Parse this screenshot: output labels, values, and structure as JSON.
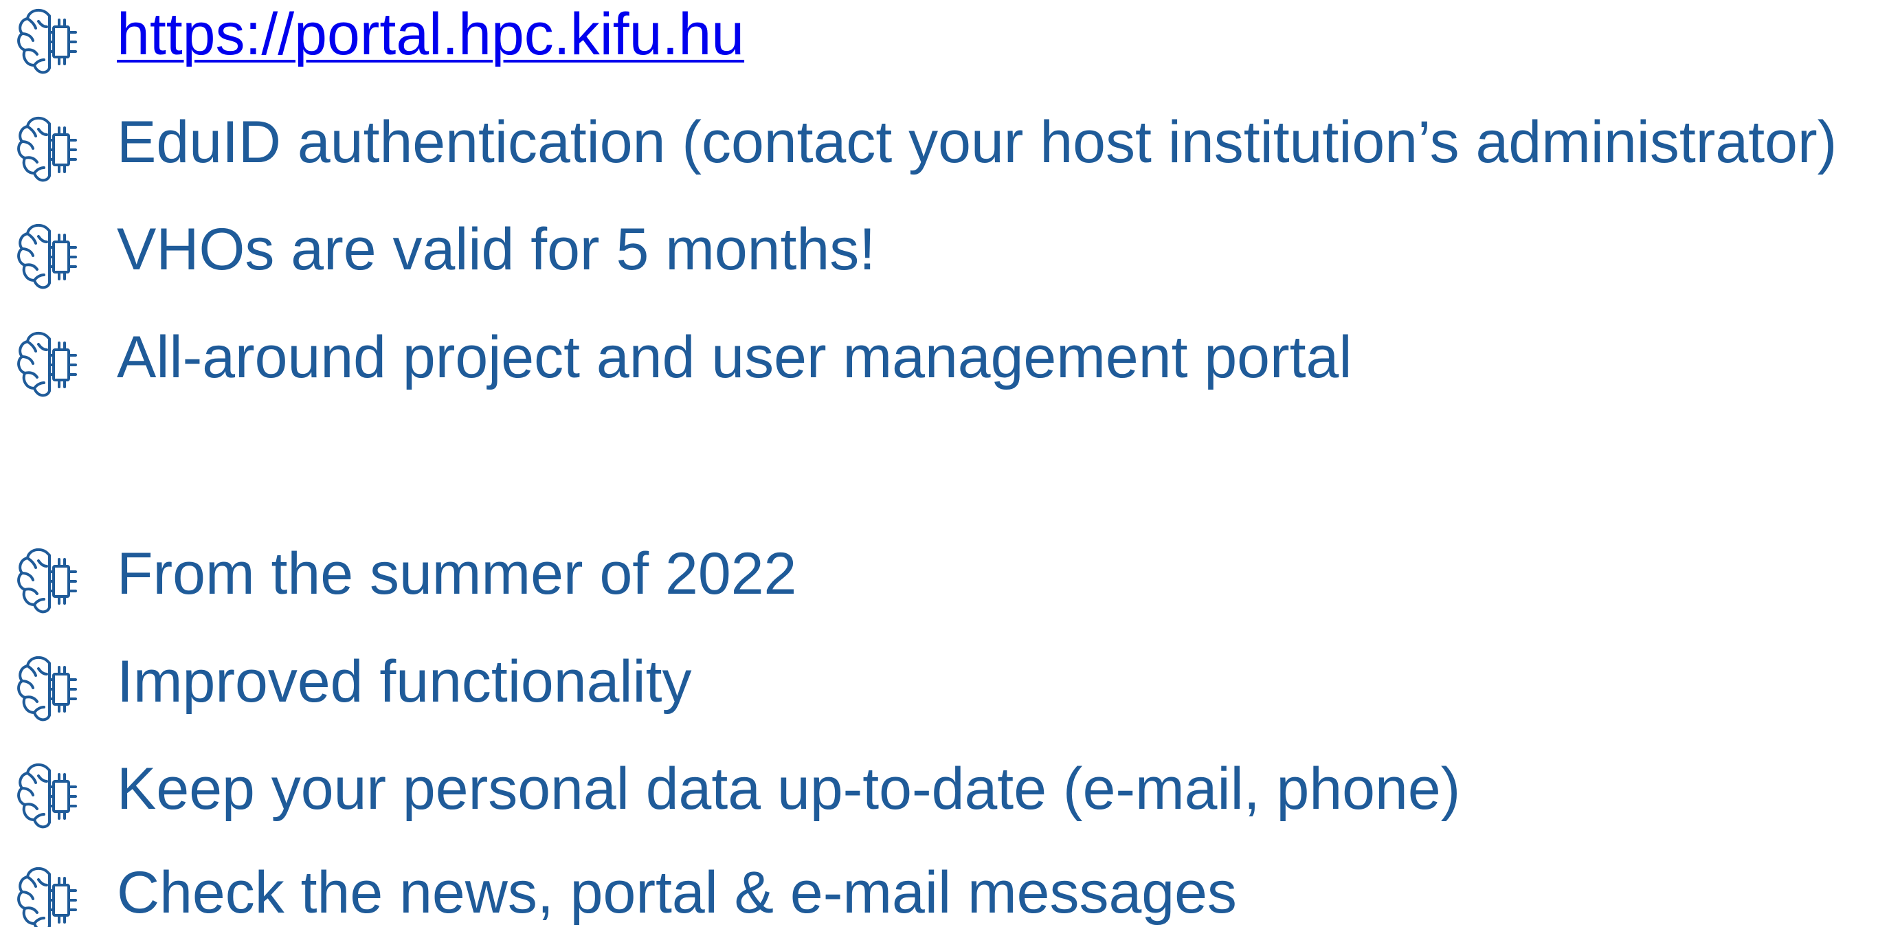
{
  "colors": {
    "text": "#1f5b99",
    "link": "#0000ee",
    "icon": "#1f5b99"
  },
  "bullet_icon_name": "brain-circuit-icon",
  "bullets": [
    {
      "text": "https://portal.hpc.kifu.hu",
      "is_link": true
    },
    {
      "text": "EduID authentication (contact your host institution’s administrator)",
      "is_link": false
    },
    {
      "text": "VHOs are valid for 5 months!",
      "is_link": false
    },
    {
      "text": "All-around project and user management portal",
      "is_link": false
    },
    {
      "text": "From the summer of 2022",
      "is_link": false
    },
    {
      "text": "Improved functionality",
      "is_link": false
    },
    {
      "text": "Keep your personal data up-to-date (e-mail, phone)",
      "is_link": false
    },
    {
      "text": "Check the news, portal & e-mail messages",
      "is_link": false
    }
  ]
}
